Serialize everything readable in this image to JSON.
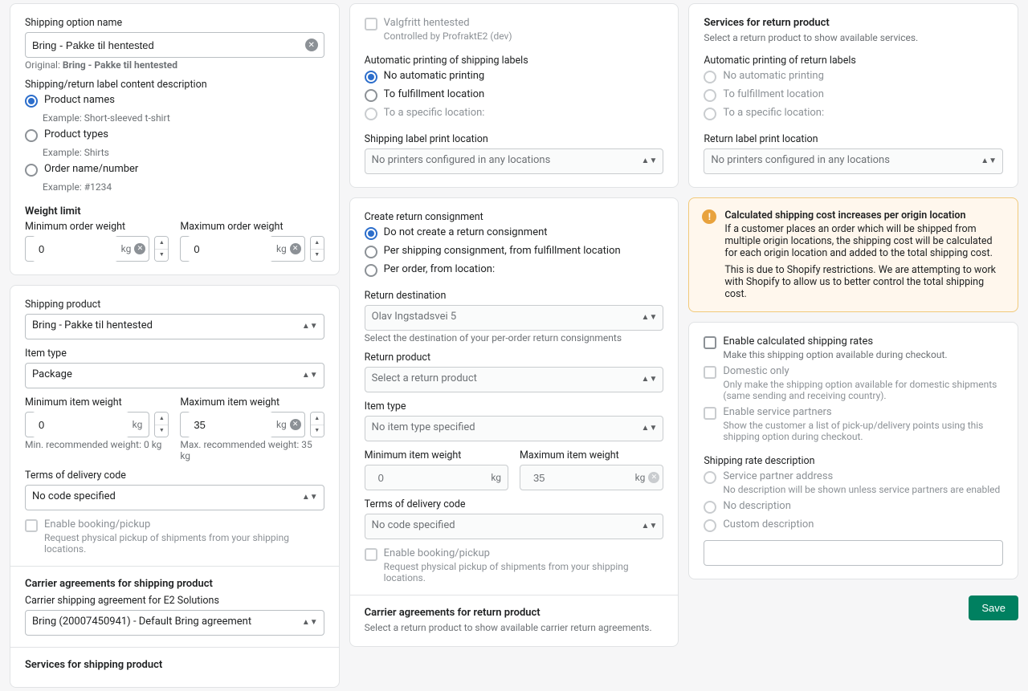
{
  "left": {
    "shipping_option_name_label": "Shipping option name",
    "shipping_option_name_value": "Bring - Pakke til hentested",
    "original_prefix": "Original: ",
    "original_value": "Bring - Pakke til hentested",
    "content_desc_label": "Shipping/return label content description",
    "content_opts": [
      {
        "label": "Product names",
        "example": "Example: Short-sleeved t-shirt",
        "checked": true
      },
      {
        "label": "Product types",
        "example": "Example: Shirts",
        "checked": false
      },
      {
        "label": "Order name/number",
        "example": "Example: #1234",
        "checked": false
      }
    ],
    "weight_limit_title": "Weight limit",
    "min_order_weight_label": "Minimum order weight",
    "min_order_weight_value": "0",
    "max_order_weight_label": "Maximum order weight",
    "max_order_weight_value": "0",
    "kg": "kg",
    "shipping_product_label": "Shipping product",
    "shipping_product_value": "Bring - Pakke til hentested",
    "item_type_label": "Item type",
    "item_type_value": "Package",
    "min_item_weight_label": "Minimum item weight",
    "min_item_weight_value": "0",
    "min_item_weight_hint": "Min. recommended weight: 0 kg",
    "max_item_weight_label": "Maximum item weight",
    "max_item_weight_value": "35",
    "max_item_weight_hint": "Max. recommended weight: 35 kg",
    "terms_label": "Terms of delivery code",
    "terms_value": "No code specified",
    "enable_booking_label": "Enable booking/pickup",
    "enable_booking_hint": "Request physical pickup of shipments from your shipping locations.",
    "carrier_agreements_title": "Carrier agreements for shipping product",
    "carrier_agreement_label": "Carrier shipping agreement for E2 Solutions",
    "carrier_agreement_value": "Bring (20007450941) - Default Bring agreement",
    "services_title": "Services for shipping product"
  },
  "mid": {
    "valgfritt_label": "Valgfritt hentested",
    "valgfritt_hint": "Controlled by ProfraktE2 (dev)",
    "auto_print_title": "Automatic printing of shipping labels",
    "auto_print_opts": [
      {
        "label": "No automatic printing",
        "checked": true,
        "disabled": false
      },
      {
        "label": "To fulfillment location",
        "checked": false,
        "disabled": false
      },
      {
        "label": "To a specific location:",
        "checked": false,
        "disabled": true
      }
    ],
    "print_location_label": "Shipping label print location",
    "print_location_value": "No printers configured in any locations",
    "create_return_title": "Create return consignment",
    "create_return_opts": [
      {
        "label": "Do not create a return consignment",
        "checked": true
      },
      {
        "label": "Per shipping consignment, from fulfillment location",
        "checked": false
      },
      {
        "label": "Per order, from location:",
        "checked": false
      }
    ],
    "return_dest_label": "Return destination",
    "return_dest_value": "Olav Ingstadsvei 5",
    "return_dest_hint": "Select the destination of your per-order return consignments",
    "return_product_label": "Return product",
    "return_product_value": "Select a return product",
    "item_type_label": "Item type",
    "item_type_value": "No item type specified",
    "min_item_weight_label": "Minimum item weight",
    "min_item_weight_value": "0",
    "max_item_weight_label": "Maximum item weight",
    "max_item_weight_value": "35",
    "kg": "kg",
    "terms_label": "Terms of delivery code",
    "terms_value": "No code specified",
    "enable_booking_label": "Enable booking/pickup",
    "enable_booking_hint": "Request physical pickup of shipments from your shipping locations.",
    "carrier_return_title": "Carrier agreements for return product",
    "carrier_return_hint": "Select a return product to show available carrier return agreements."
  },
  "right": {
    "services_return_title": "Services for return product",
    "services_return_hint": "Select a return product to show available services.",
    "auto_print_title": "Automatic printing of return labels",
    "auto_print_opts": [
      {
        "label": "No automatic printing"
      },
      {
        "label": "To fulfillment location"
      },
      {
        "label": "To a specific location:"
      }
    ],
    "print_location_label": "Return label print location",
    "print_location_value": "No printers configured in any locations",
    "alert_title": "Calculated shipping cost increases per origin location",
    "alert_body1": "If a customer places an order which will be shipped from multiple origin locations, the shipping cost will be calculated for each origin location and added to the total shipping cost.",
    "alert_body2": "This is due to Shopify restrictions. We are attempting to work with Shopify to allow us to better control the total shipping cost.",
    "enable_calc_label": "Enable calculated shipping rates",
    "enable_calc_hint": "Make this shipping option available during checkout.",
    "domestic_label": "Domestic only",
    "domestic_hint": "Only make the shipping option available for domestic shipments (same sending and receiving country).",
    "service_partners_label": "Enable service partners",
    "service_partners_hint": "Show the customer a list of pick-up/delivery points using this shipping option during checkout.",
    "rate_desc_label": "Shipping rate description",
    "rate_desc_opts": [
      {
        "label": "Service partner address",
        "hint": "No description will be shown unless service partners are enabled"
      },
      {
        "label": "No description"
      },
      {
        "label": "Custom description"
      }
    ],
    "save": "Save"
  }
}
